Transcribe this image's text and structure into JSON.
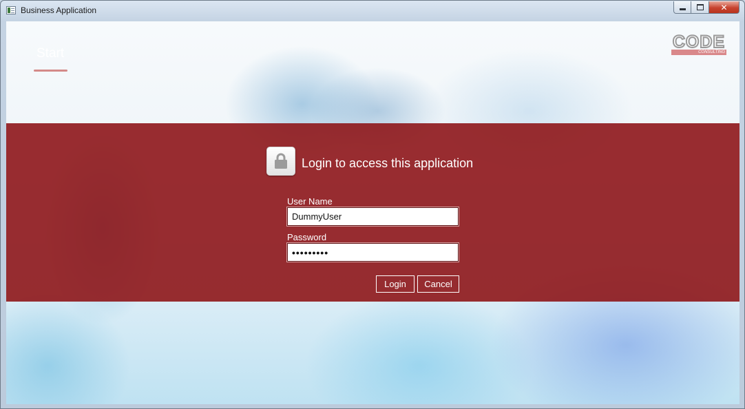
{
  "window": {
    "title": "Business Application",
    "caption": {
      "minimize": "minimize",
      "maximize": "maximize",
      "close": "✕"
    }
  },
  "nav": {
    "start_label": "Start"
  },
  "logo": {
    "main": "CODE",
    "sub": "CONSULTING"
  },
  "login": {
    "title": "Login to access this application",
    "username_label": "User Name",
    "username_value": "DummyUser",
    "password_label": "Password",
    "password_value": "dummypass",
    "login_button": "Login",
    "cancel_button": "Cancel"
  },
  "icons": {
    "app": "app-window-icon",
    "lock": "lock-icon"
  },
  "colors": {
    "band": "#8e161a",
    "accent": "#d48a88",
    "close_button": "#c7432f"
  }
}
